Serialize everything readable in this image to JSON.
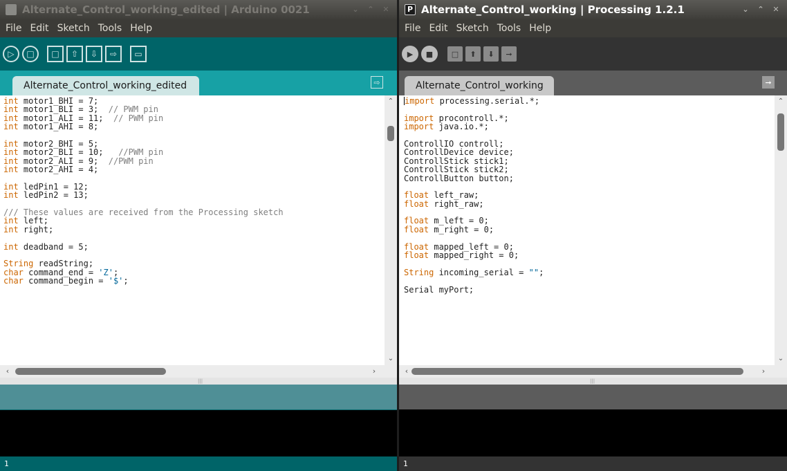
{
  "left_window": {
    "title": "Alternate_Control_working_edited | Arduino 0021",
    "menu": [
      "File",
      "Edit",
      "Sketch",
      "Tools",
      "Help"
    ],
    "tab_label": "Alternate_Control_working_edited",
    "status_line": "1",
    "code": [
      [
        [
          "kw",
          "int"
        ],
        [
          "",
          " motor1_BHI = 7;"
        ]
      ],
      [
        [
          "kw",
          "int"
        ],
        [
          "",
          " motor1_BLI = 3;  "
        ],
        [
          "cmt",
          "// PWM pin"
        ]
      ],
      [
        [
          "kw",
          "int"
        ],
        [
          "",
          " motor1_ALI = 11;  "
        ],
        [
          "cmt",
          "// PWM pin"
        ]
      ],
      [
        [
          "kw",
          "int"
        ],
        [
          "",
          " motor1_AHI = 8;"
        ]
      ],
      [],
      [
        [
          "kw",
          "int"
        ],
        [
          "",
          " motor2_BHI = 5;"
        ]
      ],
      [
        [
          "kw",
          "int"
        ],
        [
          "",
          " motor2_BLI = 10;   "
        ],
        [
          "cmt",
          "//PWM pin"
        ]
      ],
      [
        [
          "kw",
          "int"
        ],
        [
          "",
          " motor2_ALI = 9;  "
        ],
        [
          "cmt",
          "//PWM pin"
        ]
      ],
      [
        [
          "kw",
          "int"
        ],
        [
          "",
          " motor2_AHI = 4;"
        ]
      ],
      [],
      [
        [
          "kw",
          "int"
        ],
        [
          "",
          " ledPin1 = 12;"
        ]
      ],
      [
        [
          "kw",
          "int"
        ],
        [
          "",
          " ledPin2 = 13;"
        ]
      ],
      [],
      [
        [
          "cmt",
          "/// These values are received from the Processing sketch"
        ]
      ],
      [
        [
          "kw",
          "int"
        ],
        [
          "",
          " left;"
        ]
      ],
      [
        [
          "kw",
          "int"
        ],
        [
          "",
          " right;"
        ]
      ],
      [],
      [
        [
          "kw",
          "int"
        ],
        [
          "",
          " deadband = 5;"
        ]
      ],
      [],
      [
        [
          "kw",
          "String"
        ],
        [
          "",
          " readString;"
        ]
      ],
      [
        [
          "kw",
          "char"
        ],
        [
          "",
          " command_end = "
        ],
        [
          "str",
          "'Z'"
        ],
        [
          "",
          ";"
        ]
      ],
      [
        [
          "kw",
          "char"
        ],
        [
          "",
          " command_begin = "
        ],
        [
          "str",
          "'$'"
        ],
        [
          "",
          ";"
        ]
      ]
    ]
  },
  "right_window": {
    "app_icon_letter": "P",
    "title": "Alternate_Control_working | Processing 1.2.1",
    "menu": [
      "File",
      "Edit",
      "Sketch",
      "Tools",
      "Help"
    ],
    "tab_label": "Alternate_Control_working",
    "status_line": "1",
    "code": [
      [
        [
          "kw",
          "import"
        ],
        [
          "",
          " processing.serial.*;"
        ]
      ],
      [],
      [
        [
          "kw",
          "import"
        ],
        [
          "",
          " procontroll.*;"
        ]
      ],
      [
        [
          "kw",
          "import"
        ],
        [
          "",
          " java.io.*;"
        ]
      ],
      [],
      [
        [
          "",
          "ControllIO controll;"
        ]
      ],
      [
        [
          "",
          "ControllDevice device;"
        ]
      ],
      [
        [
          "",
          "ControllStick stick1;"
        ]
      ],
      [
        [
          "",
          "ControllStick stick2;"
        ]
      ],
      [
        [
          "",
          "ControllButton button;"
        ]
      ],
      [],
      [
        [
          "kw",
          "float"
        ],
        [
          "",
          " left_raw;"
        ]
      ],
      [
        [
          "kw",
          "float"
        ],
        [
          "",
          " right_raw;"
        ]
      ],
      [],
      [
        [
          "kw",
          "float"
        ],
        [
          "",
          " m_left = 0;"
        ]
      ],
      [
        [
          "kw",
          "float"
        ],
        [
          "",
          " m_right = 0;"
        ]
      ],
      [],
      [
        [
          "kw",
          "float"
        ],
        [
          "",
          " mapped_left = 0;"
        ]
      ],
      [
        [
          "kw",
          "float"
        ],
        [
          "",
          " mapped_right = 0;"
        ]
      ],
      [],
      [
        [
          "kw",
          "String"
        ],
        [
          "",
          " incoming_serial = "
        ],
        [
          "str",
          "\"\""
        ],
        [
          "",
          ";"
        ]
      ],
      [],
      [
        [
          "",
          "Serial myPort;"
        ]
      ]
    ]
  }
}
